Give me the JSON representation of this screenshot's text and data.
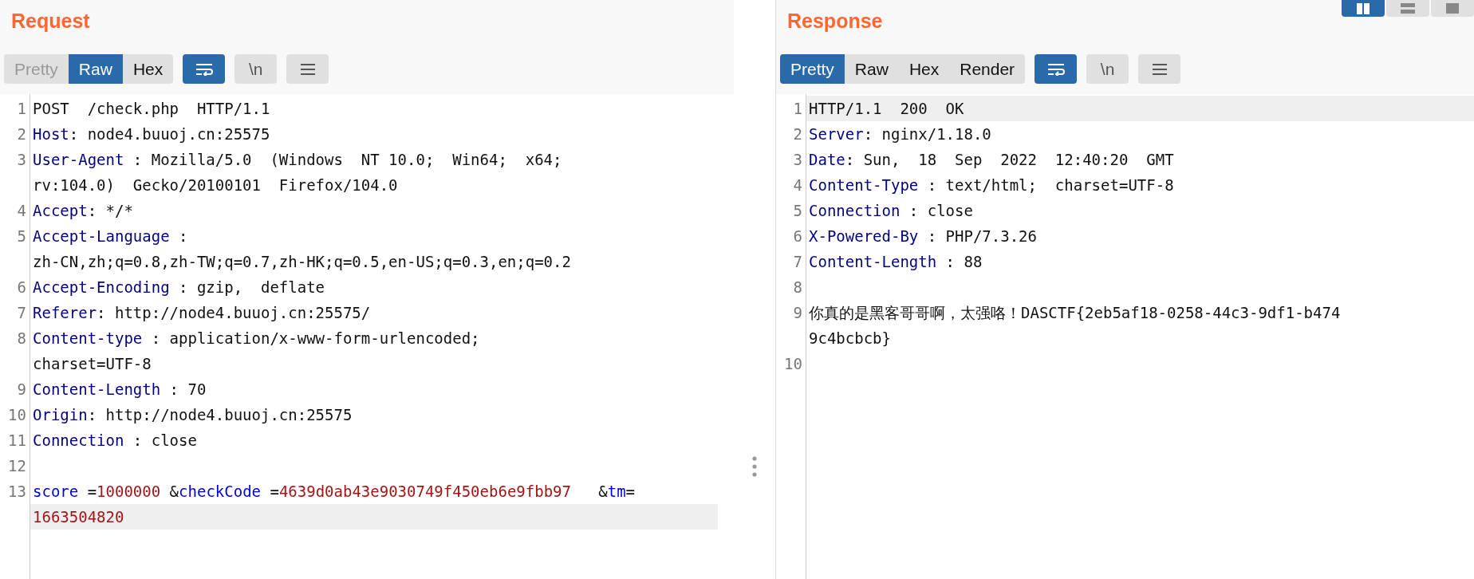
{
  "layout_buttons": [
    {
      "kind": "columns",
      "selected": true
    },
    {
      "kind": "rows",
      "selected": false
    },
    {
      "kind": "single",
      "selected": false
    }
  ],
  "panels": [
    {
      "title": "Request",
      "view_tabs": [
        {
          "label": "Pretty",
          "selected": false,
          "disabled": true
        },
        {
          "label": "Raw",
          "selected": true,
          "disabled": false
        },
        {
          "label": "Hex",
          "selected": false,
          "disabled": false
        }
      ],
      "tools": [
        {
          "kind": "wrap",
          "on": true
        },
        {
          "kind": "newline",
          "label": "\\n",
          "on": false
        },
        {
          "kind": "menu",
          "on": false
        }
      ],
      "lines": [
        {
          "number": "1",
          "rows": [
            {
              "highlighted": false,
              "segments": [
                {
                  "kind": "plain",
                  "text": "POST  /check.php  HTTP/1.1"
                }
              ]
            }
          ]
        },
        {
          "number": "2",
          "rows": [
            {
              "highlighted": false,
              "segments": [
                {
                  "kind": "name",
                  "text": "Host"
                },
                {
                  "kind": "plain",
                  "text": ": node4.buuoj.cn:25575"
                }
              ]
            }
          ]
        },
        {
          "number": "3",
          "rows": [
            {
              "highlighted": false,
              "segments": [
                {
                  "kind": "name",
                  "text": "User-Agent"
                },
                {
                  "kind": "plain",
                  "text": " : Mozilla/5.0  (Windows  NT 10.0;  Win64;  x64;"
                }
              ]
            },
            {
              "highlighted": false,
              "segments": [
                {
                  "kind": "plain",
                  "text": "rv:104.0)  Gecko/20100101  Firefox/104.0"
                }
              ]
            }
          ]
        },
        {
          "number": "4",
          "rows": [
            {
              "highlighted": false,
              "segments": [
                {
                  "kind": "name",
                  "text": "Accept"
                },
                {
                  "kind": "plain",
                  "text": ": */*"
                }
              ]
            }
          ]
        },
        {
          "number": "5",
          "rows": [
            {
              "highlighted": false,
              "segments": [
                {
                  "kind": "name",
                  "text": "Accept-Language"
                },
                {
                  "kind": "plain",
                  "text": " :"
                }
              ]
            },
            {
              "highlighted": false,
              "segments": [
                {
                  "kind": "plain",
                  "text": "zh-CN,zh;q=0.8,zh-TW;q=0.7,zh-HK;q=0.5,en-US;q=0.3,en;q=0.2"
                }
              ]
            }
          ]
        },
        {
          "number": "6",
          "rows": [
            {
              "highlighted": false,
              "segments": [
                {
                  "kind": "name",
                  "text": "Accept-Encoding"
                },
                {
                  "kind": "plain",
                  "text": " : gzip,  deflate"
                }
              ]
            }
          ]
        },
        {
          "number": "7",
          "rows": [
            {
              "highlighted": false,
              "segments": [
                {
                  "kind": "name",
                  "text": "Referer"
                },
                {
                  "kind": "plain",
                  "text": ": http://node4.buuoj.cn:25575/"
                }
              ]
            }
          ]
        },
        {
          "number": "8",
          "rows": [
            {
              "highlighted": false,
              "segments": [
                {
                  "kind": "name",
                  "text": "Content-type"
                },
                {
                  "kind": "plain",
                  "text": " : application/x-www-form-urlencoded;"
                }
              ]
            },
            {
              "highlighted": false,
              "segments": [
                {
                  "kind": "plain",
                  "text": "charset=UTF-8"
                }
              ]
            }
          ]
        },
        {
          "number": "9",
          "rows": [
            {
              "highlighted": false,
              "segments": [
                {
                  "kind": "name",
                  "text": "Content-Length"
                },
                {
                  "kind": "plain",
                  "text": " : 70"
                }
              ]
            }
          ]
        },
        {
          "number": "10",
          "rows": [
            {
              "highlighted": false,
              "segments": [
                {
                  "kind": "name",
                  "text": "Origin"
                },
                {
                  "kind": "plain",
                  "text": ": http://node4.buuoj.cn:25575"
                }
              ]
            }
          ]
        },
        {
          "number": "11",
          "rows": [
            {
              "highlighted": false,
              "segments": [
                {
                  "kind": "name",
                  "text": "Connection"
                },
                {
                  "kind": "plain",
                  "text": " : close"
                }
              ]
            }
          ]
        },
        {
          "number": "12",
          "rows": [
            {
              "highlighted": false
            }
          ]
        },
        {
          "number": "13",
          "rows": [
            {
              "highlighted": false,
              "segments": [
                {
                  "kind": "param",
                  "text": "score"
                },
                {
                  "kind": "plain",
                  "text": " ="
                },
                {
                  "kind": "param_value",
                  "text": "1000000"
                },
                {
                  "kind": "plain",
                  "text": " &"
                },
                {
                  "kind": "param",
                  "text": "checkCode"
                },
                {
                  "kind": "plain",
                  "text": " ="
                },
                {
                  "kind": "param_value",
                  "text": "4639d0ab43e9030749f450eb6e9fbb97"
                },
                {
                  "kind": "plain",
                  "text": "   &"
                },
                {
                  "kind": "param",
                  "text": "tm"
                },
                {
                  "kind": "plain",
                  "text": "="
                }
              ]
            },
            {
              "highlighted": true,
              "segments": [
                {
                  "kind": "param_value",
                  "text": "1663504820"
                }
              ]
            }
          ]
        }
      ]
    },
    {
      "title": "Response",
      "view_tabs": [
        {
          "label": "Pretty",
          "selected": true,
          "disabled": false
        },
        {
          "label": "Raw",
          "selected": false,
          "disabled": false
        },
        {
          "label": "Hex",
          "selected": false,
          "disabled": false
        },
        {
          "label": "Render",
          "selected": false,
          "disabled": false
        }
      ],
      "tools": [
        {
          "kind": "wrap",
          "on": true
        },
        {
          "kind": "newline",
          "label": "\\n",
          "on": false
        },
        {
          "kind": "menu",
          "on": false
        }
      ],
      "lines": [
        {
          "number": "1",
          "rows": [
            {
              "highlighted": true,
              "segments": [
                {
                  "kind": "plain",
                  "text": "HTTP/1.1  200  OK"
                }
              ]
            }
          ]
        },
        {
          "number": "2",
          "rows": [
            {
              "highlighted": false,
              "segments": [
                {
                  "kind": "name",
                  "text": "Server"
                },
                {
                  "kind": "plain",
                  "text": ": nginx/1.18.0"
                }
              ]
            }
          ]
        },
        {
          "number": "3",
          "rows": [
            {
              "highlighted": false,
              "segments": [
                {
                  "kind": "name",
                  "text": "Date"
                },
                {
                  "kind": "plain",
                  "text": ": Sun,  18  Sep  2022  12:40:20  GMT"
                }
              ]
            }
          ]
        },
        {
          "number": "4",
          "rows": [
            {
              "highlighted": false,
              "segments": [
                {
                  "kind": "name",
                  "text": "Content-Type"
                },
                {
                  "kind": "plain",
                  "text": " : text/html;  charset=UTF-8"
                }
              ]
            }
          ]
        },
        {
          "number": "5",
          "rows": [
            {
              "highlighted": false,
              "segments": [
                {
                  "kind": "name",
                  "text": "Connection"
                },
                {
                  "kind": "plain",
                  "text": " : close"
                }
              ]
            }
          ]
        },
        {
          "number": "6",
          "rows": [
            {
              "highlighted": false,
              "segments": [
                {
                  "kind": "name",
                  "text": "X-Powered-By"
                },
                {
                  "kind": "plain",
                  "text": " : PHP/7.3.26"
                }
              ]
            }
          ]
        },
        {
          "number": "7",
          "rows": [
            {
              "highlighted": false,
              "segments": [
                {
                  "kind": "name",
                  "text": "Content-Length"
                },
                {
                  "kind": "plain",
                  "text": " : 88"
                }
              ]
            }
          ]
        },
        {
          "number": "8",
          "rows": [
            {
              "highlighted": false
            }
          ]
        },
        {
          "number": "9",
          "rows": [
            {
              "highlighted": false,
              "segments": [
                {
                  "kind": "plain",
                  "text": "你真的是黑客哥哥啊，太强咯！DASCTF{2eb5af18-0258-44c3-9df1-b474"
                }
              ]
            },
            {
              "highlighted": false,
              "segments": [
                {
                  "kind": "plain",
                  "text": "9c4bcbcb}"
                }
              ]
            }
          ]
        },
        {
          "number": "10",
          "rows": [
            {
              "highlighted": false
            }
          ]
        }
      ]
    }
  ]
}
